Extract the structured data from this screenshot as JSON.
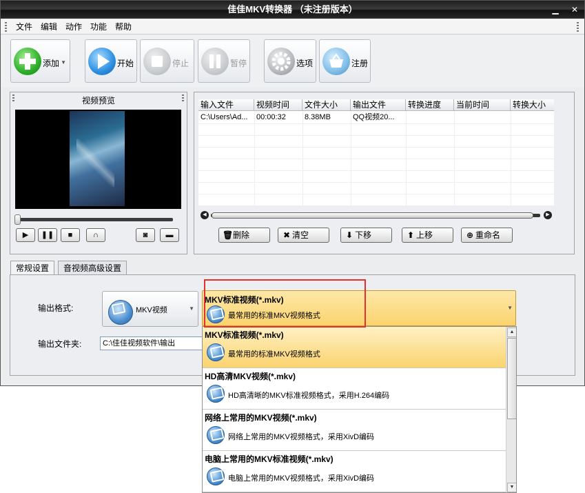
{
  "window": {
    "title": "佳佳MKV转换器 （未注册版本）"
  },
  "menu": [
    "文件",
    "编辑",
    "动作",
    "功能",
    "帮助"
  ],
  "toolbar": {
    "add": "添加",
    "start": "开始",
    "stop": "停止",
    "pause": "暂停",
    "options": "选项",
    "register": "注册"
  },
  "preview": {
    "title": "视频预览"
  },
  "file_table": {
    "columns": [
      "输入文件",
      "视频时间",
      "文件大小",
      "输出文件",
      "转换进度",
      "当前时间",
      "转换大小"
    ],
    "rows": [
      [
        "C:\\Users\\Ad...",
        "00:00:32",
        "8.38MB",
        "QQ视频20...",
        "",
        "",
        ""
      ]
    ]
  },
  "actions": {
    "delete": "删除",
    "clear": "清空",
    "move_down": "下移",
    "move_up": "上移",
    "rename": "重命名"
  },
  "tabs": [
    "常规设置",
    "音视频高级设置"
  ],
  "settings": {
    "output_format_label": "输出格式:",
    "output_folder_label": "输出文件夹:",
    "format_button": "MKV视频",
    "output_folder": "C:\\佳佳视频软件\\输出"
  },
  "selected_format": {
    "title": "MKV标准视频(*.mkv)",
    "desc": "最常用的标准MKV视频格式"
  },
  "format_options": [
    {
      "title": "MKV标准视频(*.mkv)",
      "desc": "最常用的标准MKV视频格式"
    },
    {
      "title": "HD高清MKV视频(*.mkv)",
      "desc": "HD高清晰的MKV标准视频格式，采用H.264编码"
    },
    {
      "title": "网络上常用的MKV视频(*.mkv)",
      "desc": "网络上常用的MKV视频格式，采用XivD编码"
    },
    {
      "title": "电脑上常用的MKV标准视频(*.mkv)",
      "desc": "电脑上常用的MKV视频格式，采用XivD编码"
    }
  ],
  "colors": {
    "highlight": "#fbd36d",
    "annotation": "#e3302c",
    "titlebar": "#1f1f1f"
  }
}
